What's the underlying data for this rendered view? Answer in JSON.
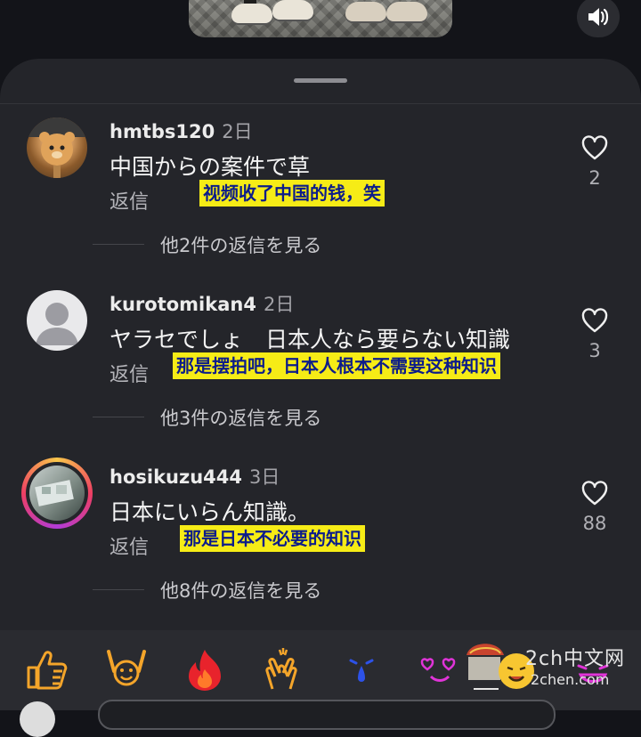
{
  "comments": [
    {
      "username": "hmtbs120",
      "time": "2日",
      "text": "中国からの案件で草",
      "reply": "返信",
      "translation": "视频收了中国的钱，笑",
      "more_replies": "他2件の返信を見る",
      "likes": "2"
    },
    {
      "username": "kurotomikan4",
      "time": "2日",
      "text": "ヤラセでしょ　日本人なら要らない知識",
      "reply": "返信",
      "translation": "那是摆拍吧，日本人根本不需要这种知识",
      "more_replies": "他3件の返信を見る",
      "likes": "3"
    },
    {
      "username": "hosikuzu444",
      "time": "3日",
      "text": "日本にいらん知識。",
      "reply": "返信",
      "translation": "那是日本不必要的知识",
      "more_replies": "他8件の返信を見る",
      "likes": "88"
    }
  ],
  "watermark": {
    "line1": "2ch中文网",
    "line2": "2chen.com"
  },
  "icons": [
    "speaker-icon",
    "heart-icon",
    "thumbs-up-emoji",
    "raised-hands-emoji",
    "fire-emoji",
    "clapping-emoji",
    "crying-emoji",
    "heart-eyes-emoji",
    "laughing-emoji"
  ],
  "colors": {
    "highlight_bg": "#f6ec16",
    "highlight_text": "#0c1c8a",
    "sheet_bg": "#24252a"
  }
}
